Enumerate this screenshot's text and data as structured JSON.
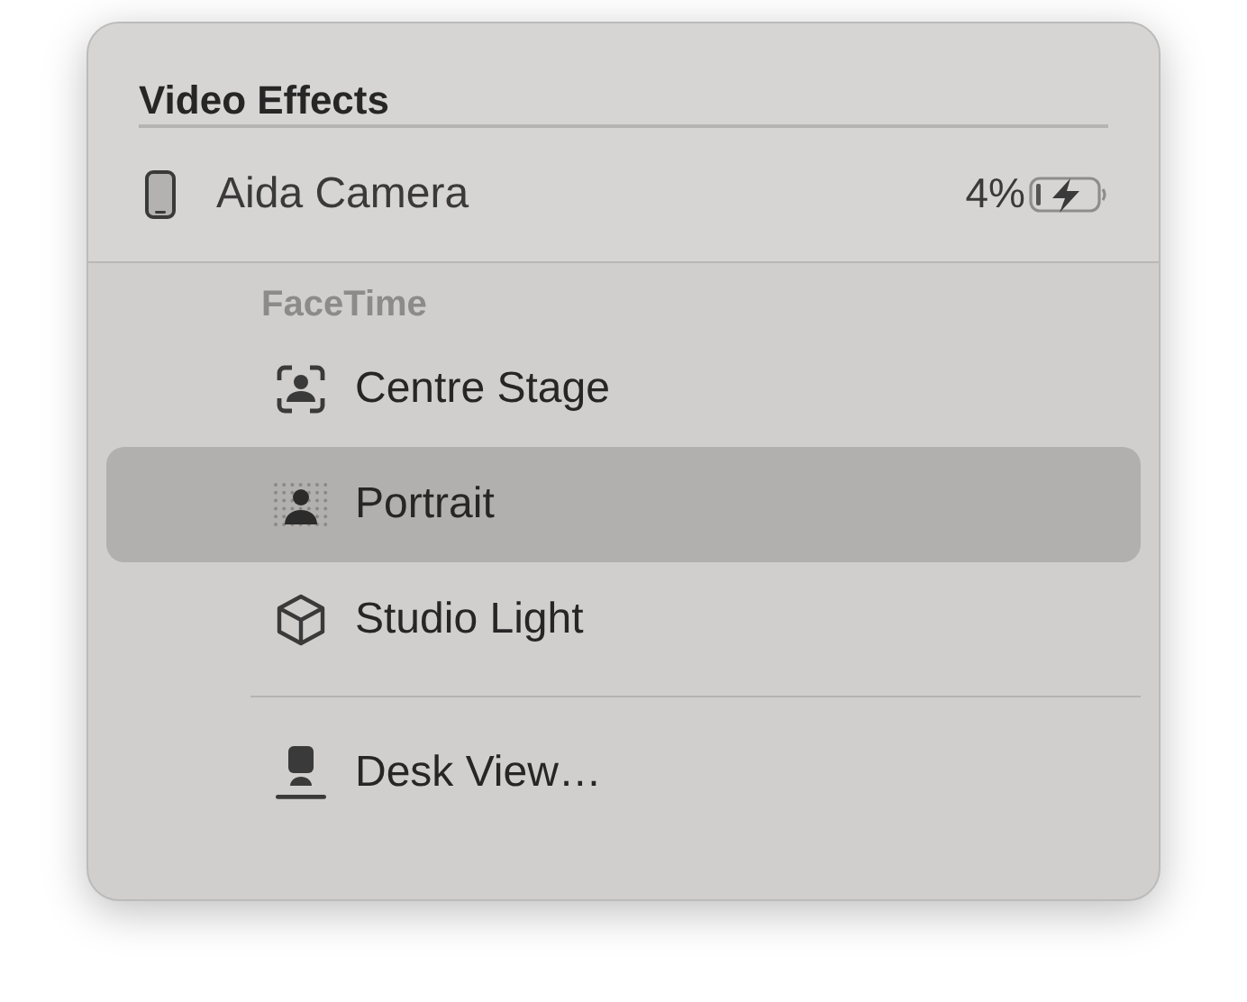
{
  "title": "Video Effects",
  "device": {
    "name": "Aida Camera",
    "battery": "4%"
  },
  "section": "FaceTime",
  "items": [
    {
      "kind": "effect",
      "label": "Centre Stage",
      "selected": false
    },
    {
      "kind": "effect",
      "label": "Portrait",
      "selected": true
    },
    {
      "kind": "effect",
      "label": "Studio Light",
      "selected": false
    },
    {
      "kind": "action",
      "label": "Desk View…",
      "selected": false
    }
  ]
}
